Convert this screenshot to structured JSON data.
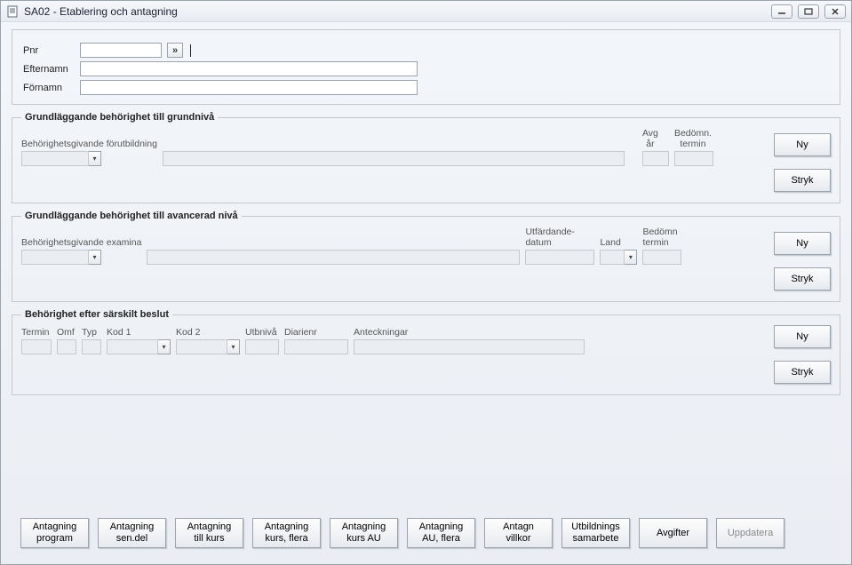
{
  "window": {
    "title": "SA02 - Etablering och antagning"
  },
  "identity": {
    "pnr_label": "Pnr",
    "pnr_value": "",
    "efternamn_label": "Efternamn",
    "efternamn_value": "",
    "fornamn_label": "Förnamn",
    "fornamn_value": ""
  },
  "group_grund": {
    "legend": "Grundläggande behörighet till grundnivå",
    "forutbildning_label": "Behörighetsgivande förutbildning",
    "avg_ar_label": "Avg\når",
    "bedomn_termin_label": "Bedömn.\ntermin",
    "ny_label": "Ny",
    "stryk_label": "Stryk"
  },
  "group_avancerad": {
    "legend": "Grundläggande behörighet till avancerad nivå",
    "examina_label": "Behörighetsgivande examina",
    "utfardande_datum_label": "Utfärdande-\ndatum",
    "land_label": "Land",
    "bedomn_termin_label": "Bedömn\ntermin",
    "ny_label": "Ny",
    "stryk_label": "Stryk"
  },
  "group_sarskilt": {
    "legend": "Behörighet efter särskilt beslut",
    "termin_label": "Termin",
    "omf_label": "Omf",
    "typ_label": "Typ",
    "kod1_label": "Kod 1",
    "kod2_label": "Kod 2",
    "utbniva_label": "Utbnivå",
    "diarienr_label": "Diarienr",
    "anteckningar_label": "Anteckningar",
    "ny_label": "Ny",
    "stryk_label": "Stryk"
  },
  "footer": {
    "buttons": [
      "Antagning\nprogram",
      "Antagning\nsen.del",
      "Antagning\ntill kurs",
      "Antagning\nkurs, flera",
      "Antagning\nkurs AU",
      "Antagning\nAU, flera",
      "Antagn\nvillkor",
      "Utbildnings\nsamarbete",
      "Avgifter",
      "Uppdatera"
    ]
  }
}
